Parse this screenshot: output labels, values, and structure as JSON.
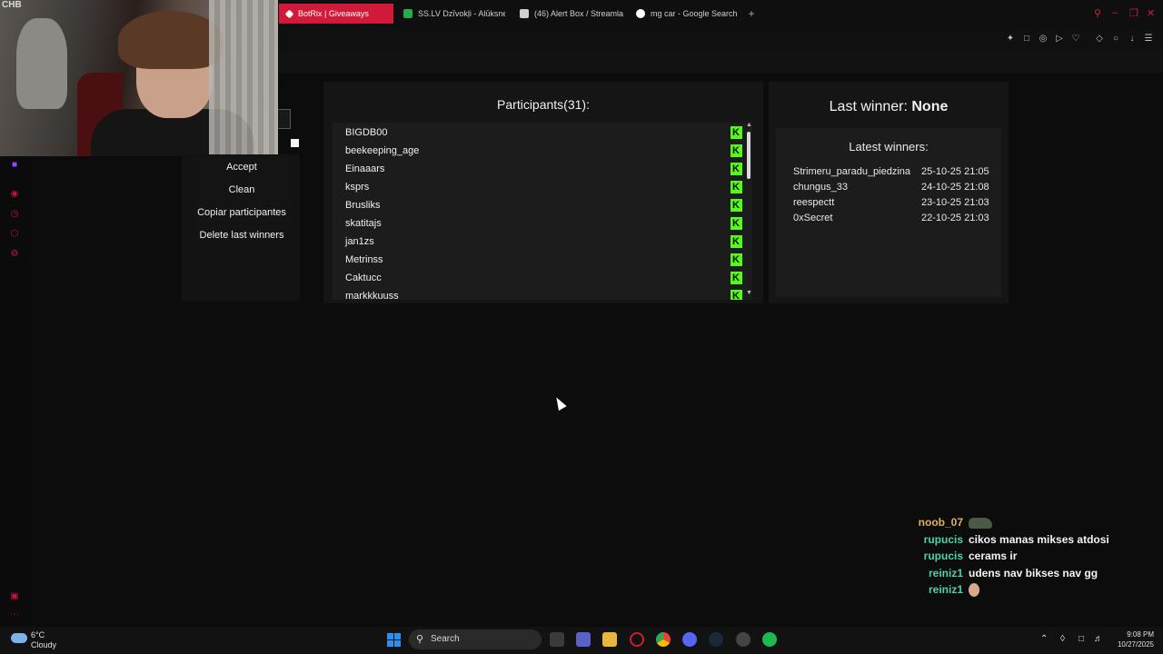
{
  "browser": {
    "tabs": [
      {
        "label": "BotRix | Giveaways",
        "active": true,
        "favicon_color": "#ffffff"
      },
      {
        "label": "SS.LV Dzīvokļi - Alūksne",
        "active": false,
        "favicon_color": "#2aa84a"
      },
      {
        "label": "(46) Alert Box / Streamlab",
        "active": false,
        "favicon_color": "#cfcfcf"
      },
      {
        "label": "mg car - Google Search",
        "active": false,
        "favicon_color": "#ffffff"
      }
    ],
    "accent_color": "#d11a3a"
  },
  "controls": {
    "accept": "Accept",
    "clean": "Clean",
    "copy_participants": "Copiar participantes",
    "delete_last_winners": "Delete last winners"
  },
  "participants": {
    "title": "Participants(31):",
    "names": [
      "BIGDB00",
      "beekeeping_age",
      "Einaaars",
      "ksprs",
      "Brusliks",
      "skatitajs",
      "jan1zs",
      "Metrinss",
      "Caktucc",
      "markkkuuss"
    ],
    "platform_badge": "K",
    "platform_color": "#53fc18"
  },
  "winners": {
    "last_winner_label": "Last winner:",
    "last_winner_value": "None",
    "latest_title": "Latest winners:",
    "rows": [
      {
        "name": "Strimeru_paradu_piedzina",
        "date": "25-10-25 21:05"
      },
      {
        "name": "chungus_33",
        "date": "24-10-25 21:08"
      },
      {
        "name": "reespectt",
        "date": "23-10-25 21:03"
      },
      {
        "name": "0xSecret",
        "date": "22-10-25 21:03"
      }
    ]
  },
  "chat": [
    {
      "user": "noob_07",
      "message": "",
      "user_color": "#e0b25a",
      "emote": "frog-emote"
    },
    {
      "user": "rupucis",
      "message": "cikos manas mikses atdosi",
      "user_color": "#4fd1a8"
    },
    {
      "user": "rupucis",
      "message": "cerams ir",
      "user_color": "#4fd1a8"
    },
    {
      "user": "reiniz1",
      "message": "udens nav bikses nav gg",
      "user_color": "#4fd1a8"
    },
    {
      "user": "reiniz1",
      "message": "",
      "user_color": "#4fd1a8",
      "emote": "face-emote"
    }
  ],
  "webcam": {
    "overlay_text": "CHB"
  },
  "taskbar": {
    "weather_temp": "6°C",
    "weather_condition": "Cloudy",
    "search_placeholder": "Search",
    "time": "9:08 PM",
    "date": "10/27/2025"
  }
}
